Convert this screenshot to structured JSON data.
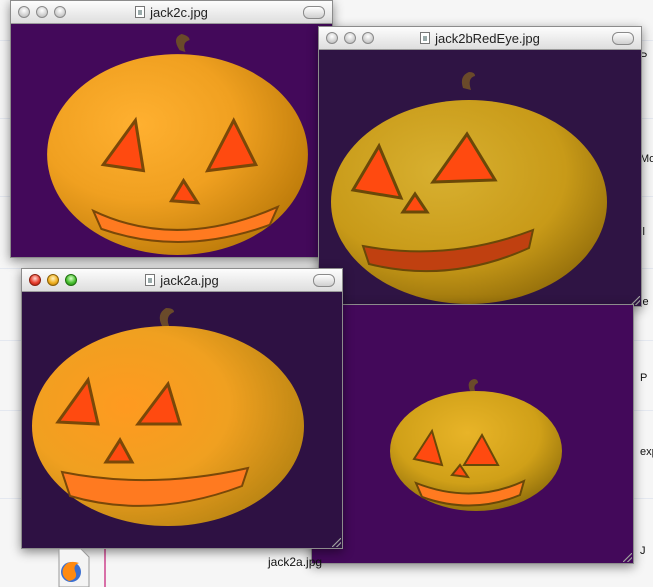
{
  "windows": [
    {
      "id": "w1",
      "title": "jack2c.jpg",
      "active": false,
      "bg": "#43095a"
    },
    {
      "id": "w2",
      "title": "jack2bRedEye.jpg",
      "active": false,
      "bg": "#2f1444"
    },
    {
      "id": "w3",
      "title": "jack2a.jpg",
      "active": true,
      "bg": "#2e1143"
    },
    {
      "id": "w4",
      "title": "",
      "active": false,
      "bg": "#43095a"
    }
  ],
  "desktop": {
    "edge_labels": [
      "P",
      "Mo",
      "ll",
      "le",
      "P",
      "exp",
      "J"
    ],
    "dock_label": "jack2a.jpg",
    "icons": [
      "firefox-icon",
      "document-icon"
    ]
  },
  "colors": {
    "pumpkin": "#d8a820",
    "pumpkin_bright": "#ffa020",
    "stem": "#6a4a2a",
    "glow": "#ff4a10",
    "accent_pink": "#d870a8"
  }
}
